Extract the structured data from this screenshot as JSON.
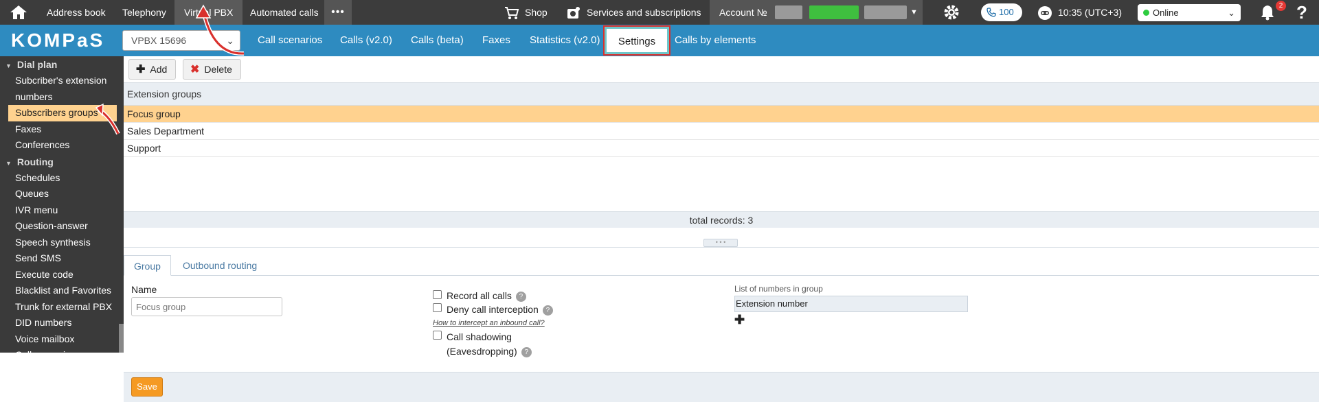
{
  "topbar": {
    "nav": [
      "Address book",
      "Telephony",
      "Virtual PBX",
      "Automated calls"
    ],
    "more": "•••",
    "shop": "Shop",
    "services": "Services and subscriptions",
    "account_label": "Account №",
    "calls_count": "100",
    "time": "10:35 (UTC+3)",
    "status": "Online",
    "notifications_count": "2",
    "help": "?"
  },
  "navbar": {
    "logo": "KOMPaS",
    "vpbx": "VPBX 15696",
    "tabs": [
      "Call scenarios",
      "Calls (v2.0)",
      "Calls (beta)",
      "Faxes",
      "Statistics (v2.0)",
      "Settings",
      "Calls by elements"
    ]
  },
  "sidebar": {
    "dial_plan": "Dial plan",
    "dial_items": [
      "Subcriber's extension numbers",
      "Subscribers groups",
      "Faxes",
      "Conferences"
    ],
    "routing": "Routing",
    "routing_items": [
      "Schedules",
      "Queues",
      "IVR menu",
      "Question-answer",
      "Speech synthesis",
      "Send SMS",
      "Execute code",
      "Blacklist and Favorites",
      "Trunk for external PBX",
      "DID numbers",
      "Voice mailbox",
      "Call scenarios"
    ]
  },
  "toolbar": {
    "add": "Add",
    "delete": "Delete"
  },
  "grid": {
    "header": "Extension groups",
    "rows": [
      "Focus group",
      "Sales Department",
      "Support"
    ],
    "footer": "total records: 3"
  },
  "form": {
    "tabs": [
      "Group",
      "Outbound routing"
    ],
    "name_label": "Name",
    "name_value": "Focus group",
    "record_all": "Record all calls",
    "deny_interception": "Deny call interception",
    "howto": "How to intercept an inbound call?",
    "shadowing_1": "Call shadowing",
    "shadowing_2": "(Eavesdropping)",
    "list_label": "List of numbers in group",
    "list_header": "Extension number",
    "save": "Save"
  },
  "colors": {
    "topbar": "#3c3c3c",
    "navbar": "#2e8bc0",
    "selected_row": "#ffd28f",
    "save": "#f59a23",
    "sidebar": "#3a3a3a"
  }
}
